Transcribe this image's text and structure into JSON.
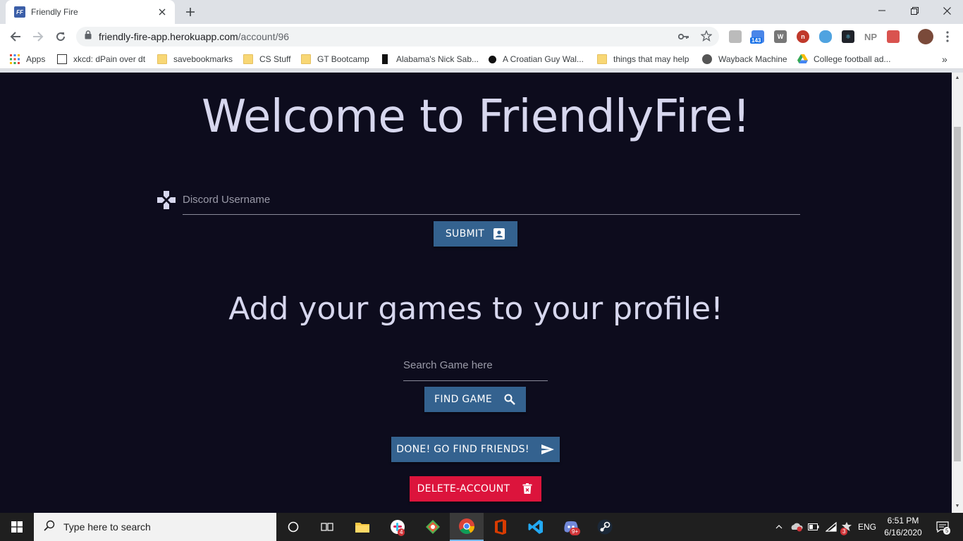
{
  "browser": {
    "tab": {
      "title": "Friendly Fire",
      "favicon_text": "FF"
    },
    "url": {
      "host": "friendly-fire-app.herokuapp.com",
      "path": "/account/96"
    },
    "extension_badges": {
      "calendar_count": "143",
      "np_label": "NP"
    },
    "bookmarks": [
      {
        "label": "Apps",
        "icon": "apps-grid-icon"
      },
      {
        "label": "xkcd: dPain over dt",
        "icon": "xkcd-icon"
      },
      {
        "label": "savebookmarks",
        "icon": "folder-icon"
      },
      {
        "label": "CS Stuff",
        "icon": "folder-icon"
      },
      {
        "label": "GT Bootcamp",
        "icon": "folder-icon"
      },
      {
        "label": "Alabama's Nick Sab...",
        "icon": "bookmark-site-icon"
      },
      {
        "label": "A Croatian Guy Wal...",
        "icon": "bookmark-site-icon"
      },
      {
        "label": "things that may help",
        "icon": "folder-icon"
      },
      {
        "label": "Wayback Machine",
        "icon": "globe-icon"
      },
      {
        "label": "College football ad...",
        "icon": "google-drive-icon"
      }
    ]
  },
  "page": {
    "heading": "Welcome to FriendlyFire!",
    "discord_input": {
      "placeholder": "Discord Username",
      "value": ""
    },
    "submit_button": "SUBMIT",
    "games_heading": "Add your games to your profile!",
    "game_search_input": {
      "placeholder": "Search Game here",
      "value": ""
    },
    "find_game_button": "FIND GAME",
    "done_button": "DONE! GO FIND FRIENDS!",
    "delete_button": "DELETE-ACCOUNT",
    "colors": {
      "background": "#0d0c1d",
      "primary_button": "#34628f",
      "danger_button": "#dc143c",
      "heading_text": "#d7d7ee"
    }
  },
  "taskbar": {
    "search_placeholder": "Type here to search",
    "badges": {
      "slack": "4",
      "discord": "9+",
      "tray_alert": "3",
      "notifications": "5"
    },
    "language": "ENG",
    "time": "6:51 PM",
    "date": "6/16/2020"
  }
}
